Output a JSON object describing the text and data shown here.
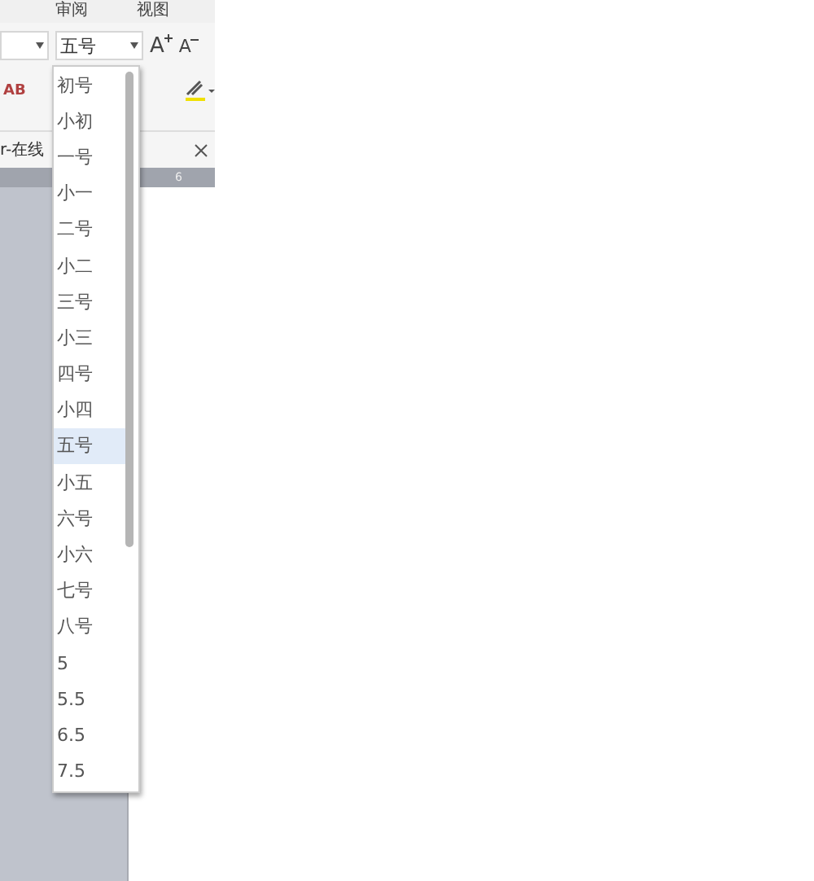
{
  "ribbon_tabs": [
    {
      "label": "审阅",
      "selected": false
    },
    {
      "label": "视图",
      "selected": false
    }
  ],
  "font_size": {
    "value": "五号"
  },
  "grow_button": "A",
  "shrink_button": "A",
  "style_button": "AB",
  "document_tab": {
    "title": "r-在线"
  },
  "ruler": {
    "mark": "6"
  },
  "size_options": [
    {
      "label": "初号",
      "selected": false
    },
    {
      "label": "小初",
      "selected": false
    },
    {
      "label": "一号",
      "selected": false
    },
    {
      "label": "小一",
      "selected": false
    },
    {
      "label": "二号",
      "selected": false
    },
    {
      "label": "小二",
      "selected": false
    },
    {
      "label": "三号",
      "selected": false
    },
    {
      "label": "小三",
      "selected": false
    },
    {
      "label": "四号",
      "selected": false
    },
    {
      "label": "小四",
      "selected": false
    },
    {
      "label": "五号",
      "selected": true
    },
    {
      "label": "小五",
      "selected": false
    },
    {
      "label": "六号",
      "selected": false
    },
    {
      "label": "小六",
      "selected": false
    },
    {
      "label": "七号",
      "selected": false
    },
    {
      "label": "八号",
      "selected": false
    },
    {
      "label": "5",
      "selected": false
    },
    {
      "label": "5.5",
      "selected": false
    },
    {
      "label": "6.5",
      "selected": false
    },
    {
      "label": "7.5",
      "selected": false
    }
  ]
}
